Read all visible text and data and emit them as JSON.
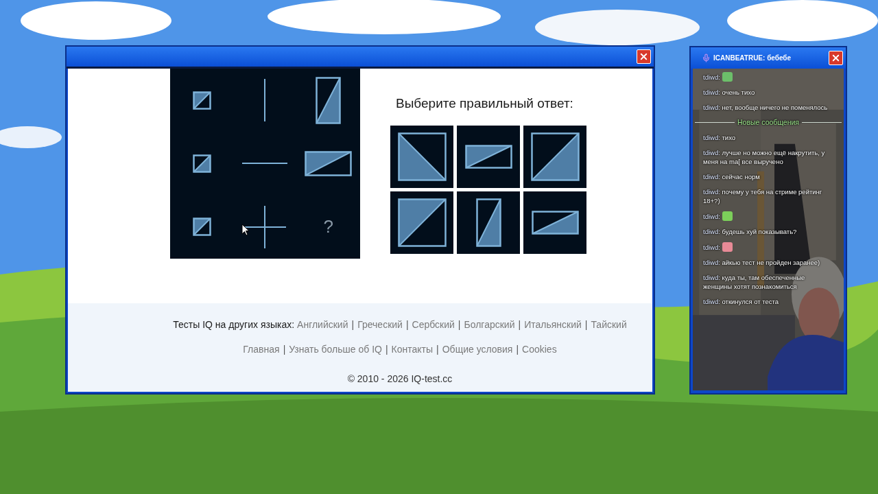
{
  "puzzle": {
    "cells": [
      {
        "kind": "figure"
      },
      {
        "kind": "figure"
      },
      {
        "kind": "figure"
      },
      {
        "kind": "figure"
      },
      {
        "kind": "figure"
      },
      {
        "kind": "figure"
      },
      {
        "kind": "figure"
      },
      {
        "kind": "figure"
      },
      {
        "kind": "question",
        "text": "?"
      }
    ]
  },
  "answers": {
    "heading": "Выберите правильный ответ:"
  },
  "footer": {
    "languages_label": "Тесты IQ на других языках:",
    "separator": "|",
    "languages": [
      "Английский",
      "Греческий",
      "Сербский",
      "Болгарский",
      "Итальянский",
      "Тайский"
    ],
    "nav": [
      "Главная",
      "Узнать больше об IQ",
      "Контакты",
      "Общие условия",
      "Cookies"
    ],
    "copyright": "© 2010 - 2026 IQ-test.cc"
  },
  "chat_window": {
    "title": "ICANBEATRUE: бебебе",
    "messages": [
      {
        "kind": "emote",
        "user": "tdiwd:",
        "color": "#6cbf6a"
      },
      {
        "kind": "text",
        "user": "tdiwd:",
        "text": "очень тихо"
      },
      {
        "kind": "text",
        "user": "tdiwd:",
        "text": "нет, вообще ничего не поменялось"
      },
      {
        "kind": "divider",
        "text": "Новые сообщения"
      },
      {
        "kind": "text",
        "user": "tdiwd:",
        "text": "тихо"
      },
      {
        "kind": "text",
        "user": "tdiwd:",
        "text": "лучше но можно ещё накрутить, у меня на ma[ все выручено"
      },
      {
        "kind": "text",
        "user": "tdiwd:",
        "text": "сейчас норм"
      },
      {
        "kind": "text",
        "user": "tdiwd:",
        "text": "почему у тебя на стриме рейтинг 18+?)"
      },
      {
        "kind": "emote",
        "user": "tdiwd:",
        "color": "#7ccf5a"
      },
      {
        "kind": "text",
        "user": "tdiwd:",
        "text": "будешь хуй показывать?"
      },
      {
        "kind": "emote",
        "user": "tdiwd:",
        "color": "#e88a96"
      },
      {
        "kind": "text",
        "user": "tdiwd:",
        "text": "айкью тест не пройден заранее)"
      },
      {
        "kind": "text",
        "user": "tdiwd:",
        "text": "куда ты, там обеспеченные женщины хотят познакомиться"
      },
      {
        "kind": "text",
        "user": "tdiwd:",
        "text": "откинулся от теста"
      }
    ]
  }
}
